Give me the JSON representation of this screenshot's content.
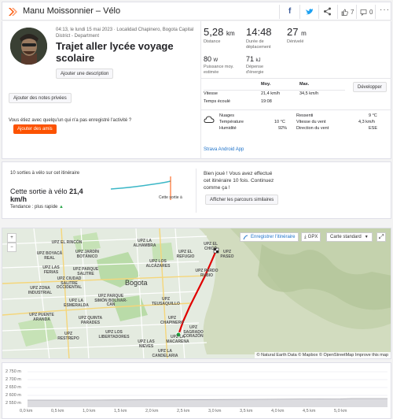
{
  "header": {
    "title": "Manu Moissonnier – Vélo",
    "kudos_count": "7",
    "comments_count": "0",
    "brand_color": "#fc5200"
  },
  "activity": {
    "meta_line1": "04:13, le lundi 15 mai 2023 · Localidad Chapinero, Bogota Capital",
    "meta_line2": "District - Department",
    "title": "Trajet aller lycée voyage scolaire",
    "add_description_label": "Ajouter une description",
    "private_notes_label": "Ajouter des notes privées",
    "cyclist_question": "Vous étiez avec quelqu'un qui n'a pas enregistré l'activité ?",
    "add_friends_label": "Ajouter des amis"
  },
  "stats": {
    "distance_value": "5,28",
    "distance_unit": "km",
    "distance_label": "Distance",
    "moving_time_value": "14:48",
    "moving_time_label_1": "Durée de",
    "moving_time_label_2": "déplacement",
    "elevation_value": "27",
    "elevation_unit": "m",
    "elevation_label": "Dénivelé",
    "power_value": "80",
    "power_unit": "W",
    "power_label_1": "Puissance moy.",
    "power_label_2": "estimée",
    "energy_value": "71",
    "energy_unit": "kJ",
    "energy_label_1": "Dépense",
    "energy_label_2": "d'énergie"
  },
  "speed_table": {
    "col_avg": "Moy.",
    "col_max": "Max.",
    "develop_label": "Développer",
    "row1_label": "Vitesse",
    "row1_avg": "21,4 km/h",
    "row1_max": "34,5 km/h",
    "row2_label": "Temps écoulé",
    "row2_avg": "19:08"
  },
  "weather": {
    "condition": "Nuages",
    "temp_label": "Température",
    "temp_value": "10 °C",
    "humidity_label": "Humidité",
    "humidity_value": "92%",
    "feels_label": "Ressenti",
    "feels_value": "9 °C",
    "wind_speed_label": "Vitesse du vent",
    "wind_speed_value": "4,3 km/h",
    "wind_dir_label": "Direction du vent",
    "wind_dir_value": "ESE",
    "device_link": "Strava Android App"
  },
  "segment": {
    "rides_text": "10 sorties à vélo sur cet itinéraire",
    "this_ride_prefix": "Cette sortie à vélo",
    "this_ride_speed": "21,4",
    "this_ride_unit": "km/h",
    "trend_text": "Tendance : plus rapide",
    "trend_arrow": "▲",
    "marker_label": "Cette sortie à",
    "congrats_1": "Bien joué ! Vous avez effectué",
    "congrats_2": "cet itinéraire 10 fois. Continuez",
    "congrats_3": "comme ça !",
    "similar_routes_label": "Afficher les parcours similaires"
  },
  "map": {
    "zoom_in": "+",
    "zoom_out": "−",
    "save_route_label": "Enregistrer l'itinéraire",
    "gpx_label": "GPX",
    "map_type_label": "Carte standard",
    "city_label": "Bogota",
    "attribution": "© Natural Earth Data © Mapbox © OpenStreetMap Improve this map",
    "place_labels": [
      "UPZ EL RINCÓN",
      "UPZ BOYACÁ REAL",
      "UPZ LA ALHAMBRA",
      "UPZ JARDÍN BOTÁNICO",
      "UPZ LAS FERIAS",
      "UPZ EL REFUGIO",
      "UPZ LOS ALCÁZARES",
      "UPZ PARQUE SALITRE",
      "UPZ CIUDAD SALITRE OCCIDENTAL",
      "UPZ ZONA INDUSTRIAL",
      "UPZ PARQUE SIMÓN BOLÍVAR-CAN",
      "UPZ LA ESMERALDA",
      "UPZ TEUSAQUILLO",
      "UPZ PUENTE ARANDA",
      "UPZ QUINTA PARADES",
      "UPZ CHAPINERO",
      "UPZ PARDO RUBIO",
      "UPZ SAGRADO CORAZÓN",
      "UPZ LA MACARENA",
      "UPZ LAS NIEVES",
      "UPZ LA CANDELARIA",
      "UPZ RESTREPO",
      "UPZ LOS LIBERTADORES",
      "UPZ EL CHICÓ",
      "UPZ PASEO"
    ]
  },
  "elevation": {
    "y_ticks": [
      "2 750 m",
      "2 700 m",
      "2 650 m",
      "2 600 m",
      "2 550 m"
    ],
    "x_ticks": [
      "0,0 km",
      "0,5 km",
      "1,0 km",
      "1,5 km",
      "2,0 km",
      "2,5 km",
      "3,0 km",
      "3,5 km",
      "4,0 km",
      "4,5 km",
      "5,0 km"
    ]
  }
}
